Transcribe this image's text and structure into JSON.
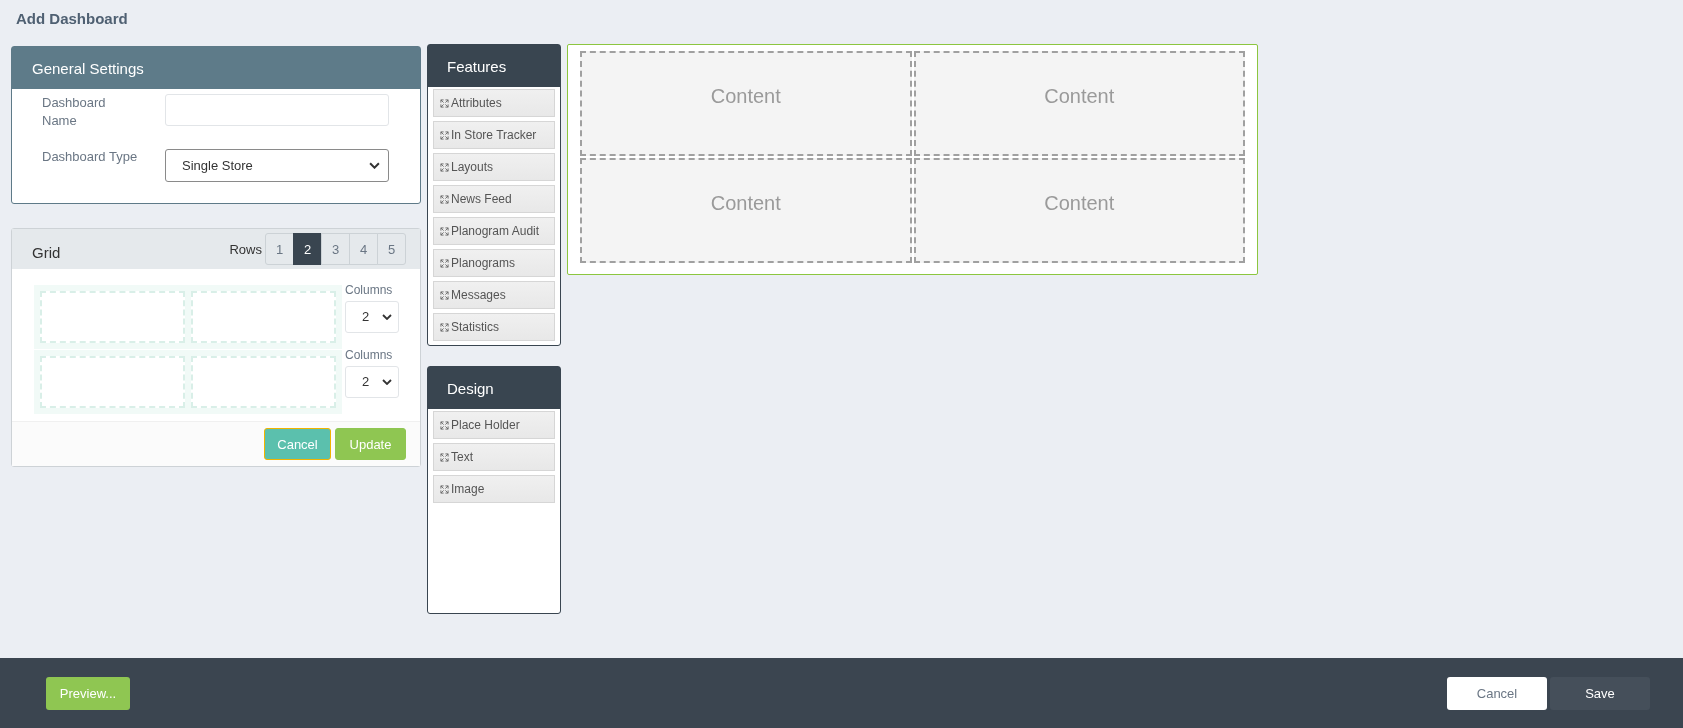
{
  "page_title": "Add Dashboard",
  "general_settings": {
    "title": "General Settings",
    "fields": [
      {
        "kind": "text",
        "label": "Dashboard Name"
      },
      {
        "kind": "select",
        "label": "Dashboard Type",
        "value": "Single Store"
      }
    ]
  },
  "grid": {
    "title": "Grid",
    "rows_label": "Rows",
    "row_options": [
      {
        "label": "1",
        "selected": false
      },
      {
        "label": "2",
        "selected": true
      },
      {
        "label": "3",
        "selected": false
      },
      {
        "label": "4",
        "selected": false
      },
      {
        "label": "5",
        "selected": false
      }
    ],
    "rows": [
      {
        "columns_label": "Columns",
        "columns": "2"
      },
      {
        "columns_label": "Columns",
        "columns": "2"
      }
    ],
    "buttons": [
      {
        "kind": "cancel",
        "label": "Cancel"
      },
      {
        "kind": "update",
        "label": "Update"
      }
    ]
  },
  "features": {
    "title": "Features",
    "items": [
      "Attributes",
      "In Store Tracker",
      "Layouts",
      "News Feed",
      "Planogram Audit",
      "Planograms",
      "Messages",
      "Statistics"
    ]
  },
  "design": {
    "title": "Design",
    "items": [
      "Place Holder",
      "Text",
      "Image"
    ]
  },
  "content_area": {
    "rows": [
      {
        "cells": [
          "Content",
          "Content"
        ]
      },
      {
        "cells": [
          "Content",
          "Content"
        ]
      }
    ]
  },
  "footer": {
    "preview": "Preview...",
    "cancel": "Cancel",
    "save": "Save"
  }
}
